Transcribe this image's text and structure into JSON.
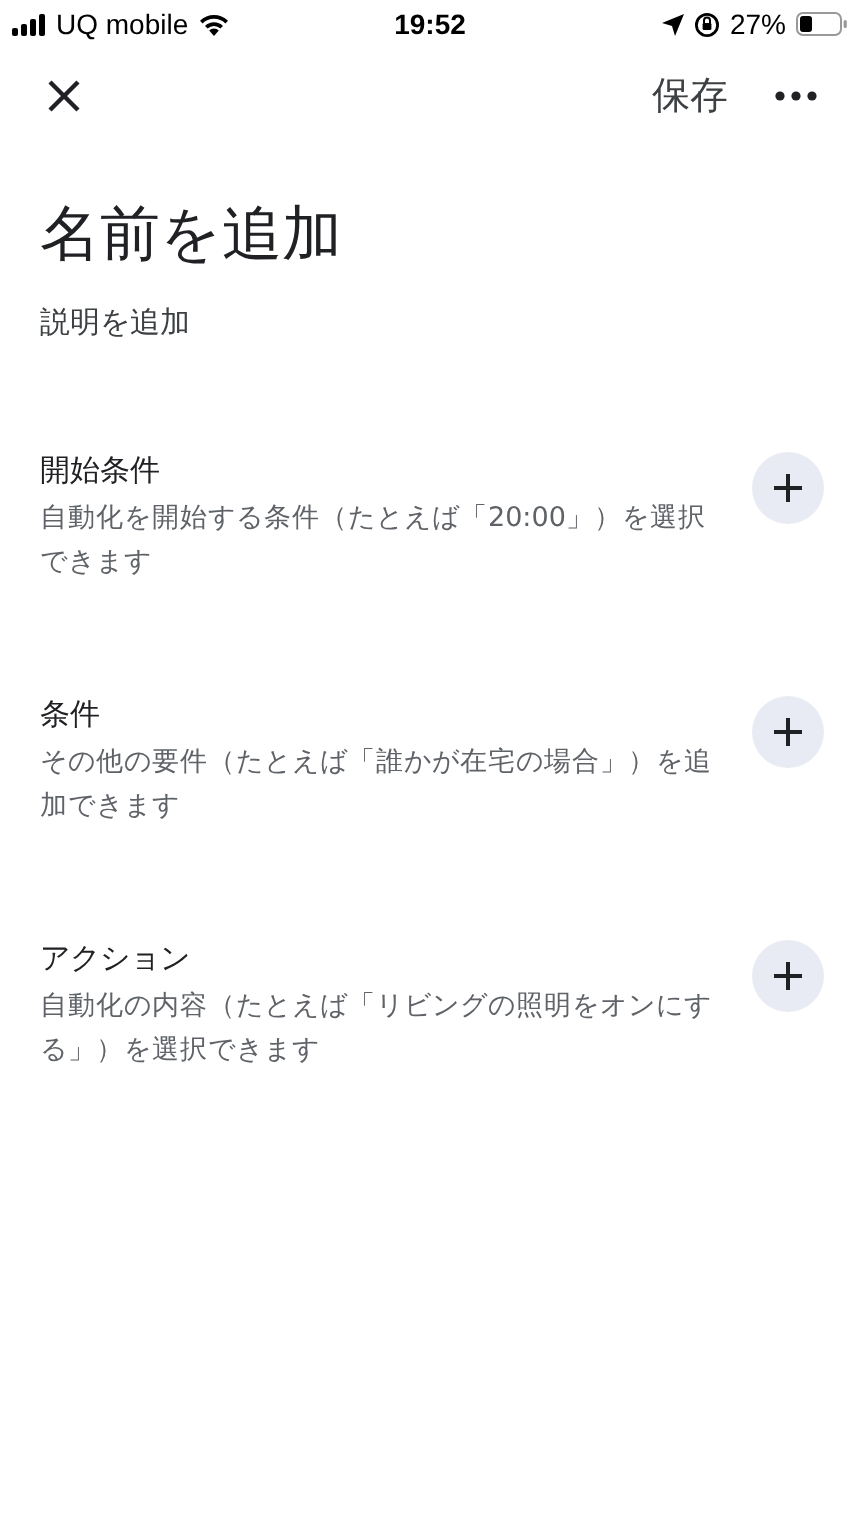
{
  "status_bar": {
    "carrier": "UQ mobile",
    "time": "19:52",
    "battery": "27%"
  },
  "top_bar": {
    "save": "保存"
  },
  "title": "名前を追加",
  "description_placeholder": "説明を追加",
  "sections": [
    {
      "title": "開始条件",
      "description": "自動化を開始する条件（たとえば「20:00」）を選択できます"
    },
    {
      "title": "条件",
      "description": "その他の要件（たとえば「誰かが在宅の場合」）を追加できます"
    },
    {
      "title": "アクション",
      "description": "自動化の内容（たとえば「リビングの照明をオンにする」）を選択できます"
    }
  ]
}
